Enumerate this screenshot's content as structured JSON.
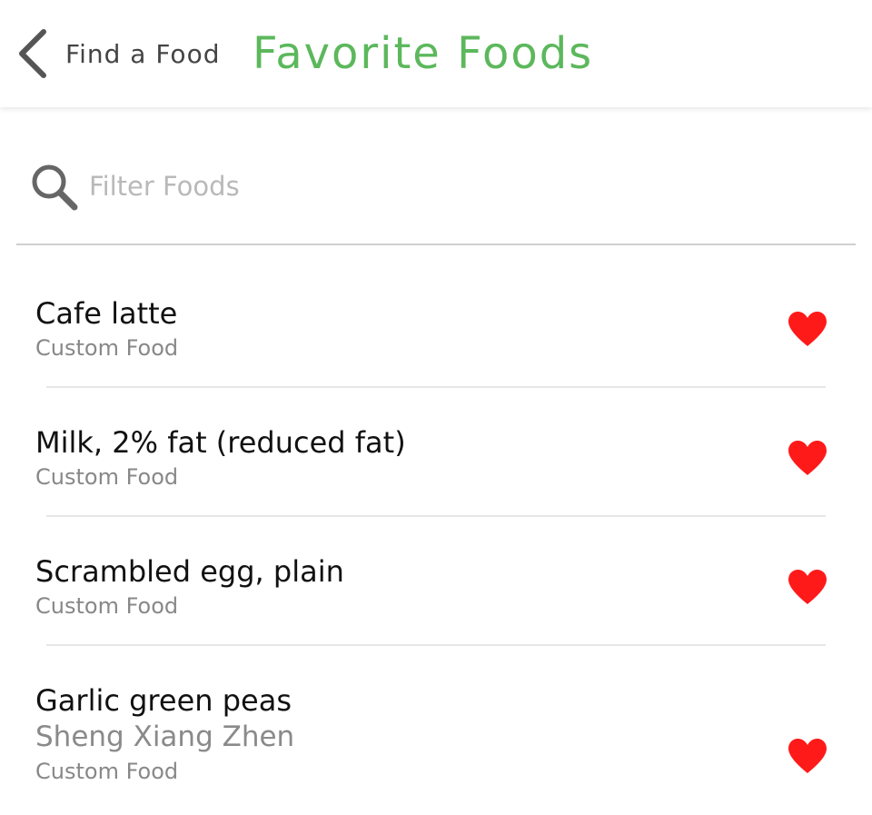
{
  "header": {
    "back_label": "Find a Food",
    "title": "Favorite Foods",
    "title_color": "#5cb85c"
  },
  "search": {
    "placeholder": "Filter Foods",
    "value": "",
    "icon": "search-icon"
  },
  "foods": [
    {
      "name": "Cafe latte",
      "brand": "",
      "source": "Custom Food",
      "favorite": true
    },
    {
      "name": "Milk, 2% fat (reduced fat)",
      "brand": "",
      "source": "Custom Food",
      "favorite": true
    },
    {
      "name": "Scrambled egg, plain",
      "brand": "",
      "source": "Custom Food",
      "favorite": true
    },
    {
      "name": "Garlic green peas",
      "brand": "Sheng Xiang Zhen",
      "source": "Custom Food",
      "favorite": true
    }
  ],
  "colors": {
    "favorite_heart": "#ff1a1a",
    "divider": "#e6e6e6"
  }
}
